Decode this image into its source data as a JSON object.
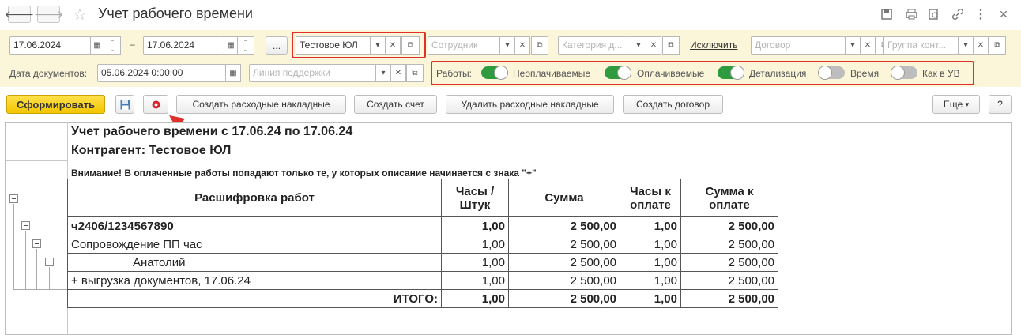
{
  "window": {
    "title": "Учет рабочего времени",
    "back_icon": "arrow-left-icon",
    "forward_icon": "arrow-right-icon",
    "favorite_icon": "star-icon"
  },
  "filters": {
    "date_from": "17.06.2024",
    "date_dash": "–",
    "date_to": "17.06.2024",
    "ellipsis": "...",
    "org": "Тестовое ЮЛ",
    "employee_placeholder": "Сотрудник",
    "category_placeholder": "Категория д...",
    "exclude_link": "Исключить",
    "contract_placeholder": "Договор",
    "group_placeholder": "Группа конт...",
    "doc_date_label": "Дата документов:",
    "doc_date": "05.06.2024  0:00:00",
    "support_line_placeholder": "Линия поддержки",
    "works_label": "Работы:",
    "toggles": [
      {
        "label": "Неоплачиваемые",
        "on": true
      },
      {
        "label": "Оплачиваемые",
        "on": true
      },
      {
        "label": "Детализация",
        "on": true
      },
      {
        "label": "Время",
        "on": false
      },
      {
        "label": "Как в УВ",
        "on": false
      }
    ]
  },
  "toolbar": {
    "generate": "Сформировать",
    "create_invoices": "Создать расходные накладные",
    "create_bill": "Создать счет",
    "delete_invoices": "Удалить расходные накладные",
    "create_contract": "Создать договор",
    "more": "Еще",
    "help": "?"
  },
  "report": {
    "title1": "Учет рабочего времени с 17.06.24 по 17.06.24",
    "title2": "Контрагент: Тестовое ЮЛ",
    "warning": "Внимание! В оплаченные работы попадают только те, у которых описание начинается с знака \"+\"",
    "headers": {
      "work": "Расшифровка работ",
      "hours1": "Часы /",
      "hours2": "Штук",
      "sum": "Сумма",
      "hpay1": "Часы к",
      "hpay2": "оплате",
      "spay1": "Сумма к",
      "spay2": "оплате"
    },
    "rows": [
      {
        "name": "ч2406/1234567890",
        "hours": "1,00",
        "sum": "2 500,00",
        "hpay": "1,00",
        "spay": "2 500,00"
      },
      {
        "name": "Сопровождение ПП час",
        "hours": "1,00",
        "sum": "2 500,00",
        "hpay": "1,00",
        "spay": "2 500,00"
      },
      {
        "name": "Анатолий",
        "hours": "1,00",
        "sum": "2 500,00",
        "hpay": "1,00",
        "spay": "2 500,00"
      },
      {
        "name": "+ выгрузка документов, 17.06.24",
        "hours": "1,00",
        "sum": "2 500,00",
        "hpay": "1,00",
        "spay": "2 500,00"
      }
    ],
    "total": {
      "label": "ИТОГО:",
      "hours": "1,00",
      "sum": "2 500,00",
      "hpay": "1,00",
      "spay": "2 500,00"
    }
  },
  "colors": {
    "accent_red": "#e0302a",
    "toggle_on": "#2f9b3f",
    "panel_bg": "#fbf5d9",
    "primary": "#f2c500"
  }
}
